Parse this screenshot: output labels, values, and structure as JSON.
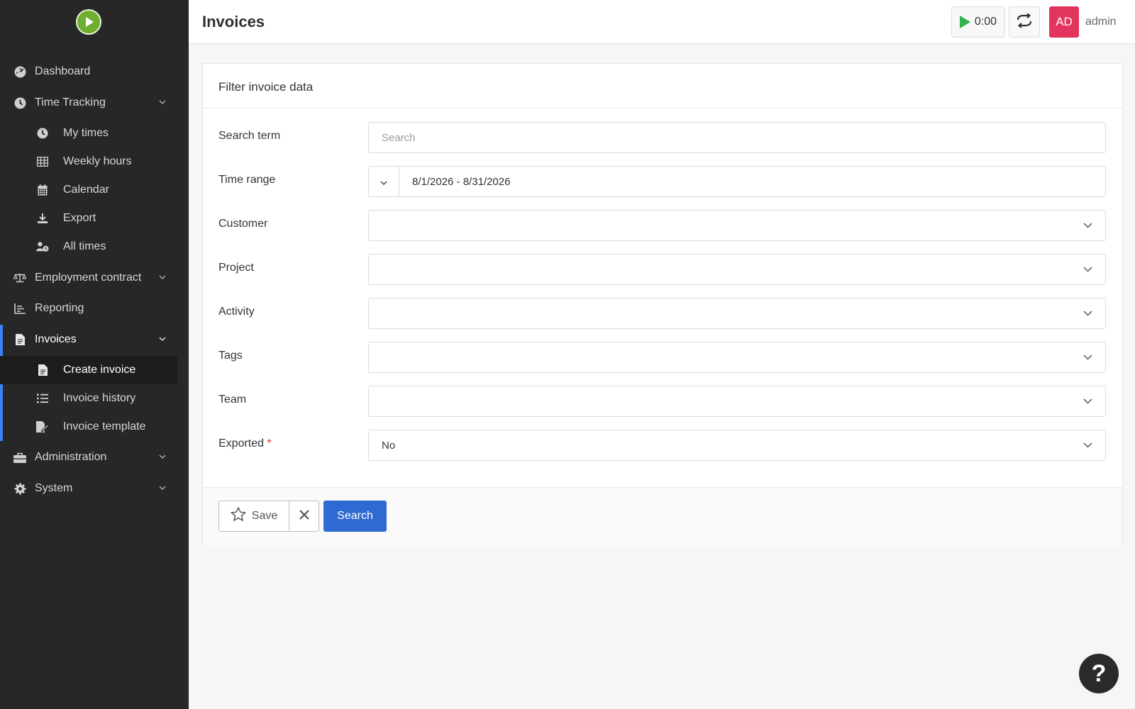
{
  "app": {
    "logo_icon": "play-circle-icon"
  },
  "sidebar": {
    "items": [
      {
        "label": "Dashboard",
        "icon": "dashboard-icon"
      },
      {
        "label": "Time Tracking",
        "icon": "clock-icon",
        "children": [
          {
            "label": "My times",
            "icon": "clock-icon"
          },
          {
            "label": "Weekly hours",
            "icon": "table-icon"
          },
          {
            "label": "Calendar",
            "icon": "calendar-icon"
          },
          {
            "label": "Export",
            "icon": "download-icon"
          },
          {
            "label": "All times",
            "icon": "user-clock-icon"
          }
        ]
      },
      {
        "label": "Employment contract",
        "icon": "scale-icon"
      },
      {
        "label": "Reporting",
        "icon": "chart-icon"
      },
      {
        "label": "Invoices",
        "icon": "invoice-icon",
        "children": [
          {
            "label": "Create invoice",
            "icon": "invoice-icon"
          },
          {
            "label": "Invoice history",
            "icon": "list-icon"
          },
          {
            "label": "Invoice template",
            "icon": "edit-document-icon"
          }
        ]
      },
      {
        "label": "Administration",
        "icon": "toolbox-icon"
      },
      {
        "label": "System",
        "icon": "gear-icon"
      }
    ]
  },
  "header": {
    "title": "Invoices",
    "timer": "0:00",
    "avatar_initials": "AD",
    "username": "admin",
    "avatar_color": "#e3345e"
  },
  "filter": {
    "title": "Filter invoice data",
    "search_term": {
      "label": "Search term",
      "placeholder": "Search",
      "value": ""
    },
    "time_range": {
      "label": "Time range",
      "value": "8/1/2026 - 8/31/2026"
    },
    "customer": {
      "label": "Customer",
      "value": ""
    },
    "project": {
      "label": "Project",
      "value": ""
    },
    "activity": {
      "label": "Activity",
      "value": ""
    },
    "tags": {
      "label": "Tags",
      "value": ""
    },
    "team": {
      "label": "Team",
      "value": ""
    },
    "exported": {
      "label": "Exported",
      "required_mark": "*",
      "value": "No"
    },
    "buttons": {
      "save": "Save",
      "search": "Search"
    }
  },
  "colors": {
    "primary": "#2e6ad1",
    "active_bar": "#3b82f6",
    "sidebar_bg": "#272727"
  },
  "help": {
    "label": "?"
  }
}
